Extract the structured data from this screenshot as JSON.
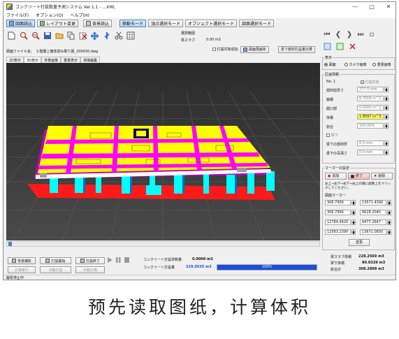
{
  "window": {
    "title": "コンクリート打設数量予測システム Ver.1.1 - ...XML",
    "controls": [
      "minimize-icon",
      "maximize-icon",
      "close-icon"
    ]
  },
  "menu": [
    "ファイル(F)",
    "オプション(O)",
    "ヘルプ(H)"
  ],
  "toolbar1": {
    "drawing_load": "図面読込",
    "layout_change": "レイアウト変更",
    "background_load": "背景読込",
    "modes": [
      "移動モード",
      "頂点選択モード",
      "オブジェクト選択モード",
      "図面選択モード"
    ],
    "active_mode": 0
  },
  "toolbar2": {
    "icons": [
      "new-file-icon",
      "zoom-in-icon",
      "zoom-out-icon",
      "save-icon",
      "open-folder-icon",
      "copy-icon",
      "delete-icon",
      "move-icon",
      "rotate-icon",
      "cut-icon",
      "grid-icon"
    ],
    "selection_range_label": "選択範囲",
    "beam_slab_label": "梁スラブ",
    "beam_slab_value": "0.00 m3",
    "pour_target_label": "打設対象追加",
    "reanalyze_button": "図面再解析",
    "beam_pour_calc_button": "梁下部材打設量計算"
  },
  "file": {
    "label": "図面ファイル名:",
    "name": "1:階層上躯体読み取り図_200630.dwg"
  },
  "view_tabs": [
    "2D表示",
    "3D表示",
    "背景画像",
    "重畳表示",
    "領域編集"
  ],
  "active_view_tab": 1,
  "right_panel": {
    "nav_icons": [
      "first-icon",
      "prev-icon",
      "next-icon",
      "last-icon",
      "window-icon"
    ],
    "tool_icons": [
      "select-tool-icon",
      "refresh-tool-icon",
      "clear-tool-icon"
    ],
    "display": {
      "label": "表示",
      "options": [
        "図面",
        "カメラ画像",
        "重畳画像"
      ],
      "selected": 0
    },
    "region_info": {
      "label": "区画情報",
      "no": "No. 1",
      "pour_target": "打設対象",
      "rows": [
        {
          "label": "部材総厚さ",
          "value": "277.5 mm"
        },
        {
          "label": "面積",
          "value": "6.7016 m^2"
        },
        {
          "label": "開口部",
          "value": "0.0000 m^2"
        },
        {
          "label": "体積",
          "value": "1.8597 m^3"
        },
        {
          "label": "割合",
          "value": "100.00%"
        }
      ],
      "under_beam_label": "梁下",
      "beam_rows": [
        {
          "label": "梁下の部材厚",
          "value": "0.0 mm"
        },
        {
          "label": "梁下の深溝さ",
          "value": "0.0 mm"
        }
      ]
    },
    "marker": {
      "label": "マーカーの設定",
      "add": "追加",
      "end": "終了",
      "delete": "削除",
      "instructions": "左上→左下→右下→右上の順に画像上をクリックしてください。",
      "drawing_marker_label": "図面マーカー",
      "coords": [
        [
          "306.7956",
          "13571.4390"
        ],
        [
          "306.7956",
          "6628.2045"
        ],
        [
          "12784.4920",
          "6477.2647"
        ],
        [
          "12583.2390",
          "13672.0650"
        ]
      ],
      "change_button": "変更"
    }
  },
  "bottom": {
    "bg_capture": "背景撮影",
    "pour_start": "打設開始",
    "pour_end": "打設終了",
    "calc_run": "計算実行",
    "manual_pour": "手動打設",
    "manual_calc": "手動計算",
    "media_icons": [
      "play-icon",
      "pause-icon",
      "stop-icon"
    ],
    "poured_label": "コンクリート打設済数量",
    "poured_value": "0.0000 m3",
    "planned_label": "コンクリート打設量",
    "planned_value": "229.0535 m3",
    "progress_pct": 100,
    "progress_text": "100%",
    "summary": [
      {
        "label": "梁スラブ体積",
        "value": "228.2569 m3"
      },
      {
        "label": "梁下体積",
        "value": "80.0329 m3"
      },
      {
        "label": "総合計",
        "value": "308.2898 m3"
      }
    ]
  },
  "status": "解析停止中",
  "caption": "预先读取图纸，计算体积",
  "colors": {
    "slab": "#ffff00",
    "beam": "#ff00ff",
    "column": "#00ffff",
    "base": "#ff0000",
    "progress": "#1c4fd8",
    "highlight": "#ffff4d"
  }
}
